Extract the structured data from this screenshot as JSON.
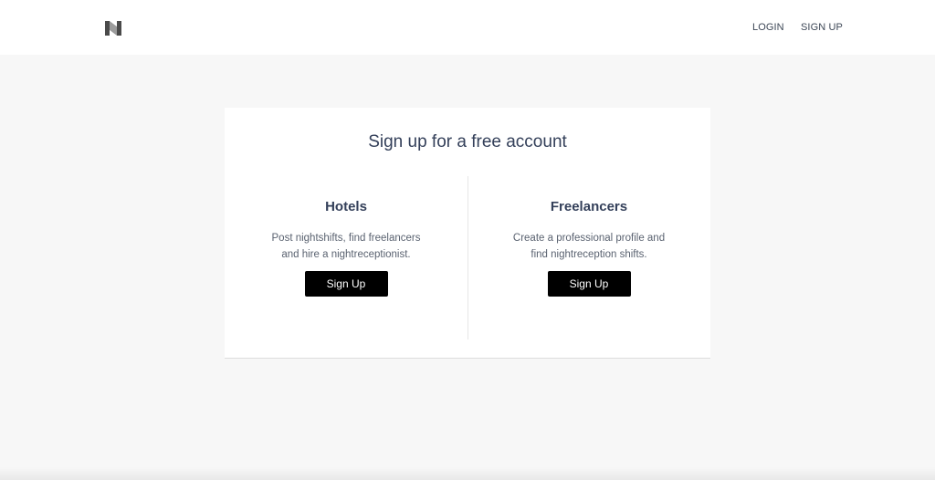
{
  "header": {
    "logo": "logo-icon",
    "nav": {
      "login": "LOGIN",
      "signup": "SIGN UP"
    }
  },
  "signup": {
    "title": "Sign up for a free account",
    "hotels": {
      "title": "Hotels",
      "description": "Post nightshifts, find freelancers\nand hire a nightreceptionist.",
      "button": "Sign Up"
    },
    "freelancers": {
      "title": "Freelancers",
      "description": "Create a professional profile and\nfind nightreception shifts.",
      "button": "Sign Up"
    }
  },
  "colors": {
    "background": "#f7f7f7",
    "card": "#ffffff",
    "text": "#34405a",
    "button": "#000000"
  }
}
